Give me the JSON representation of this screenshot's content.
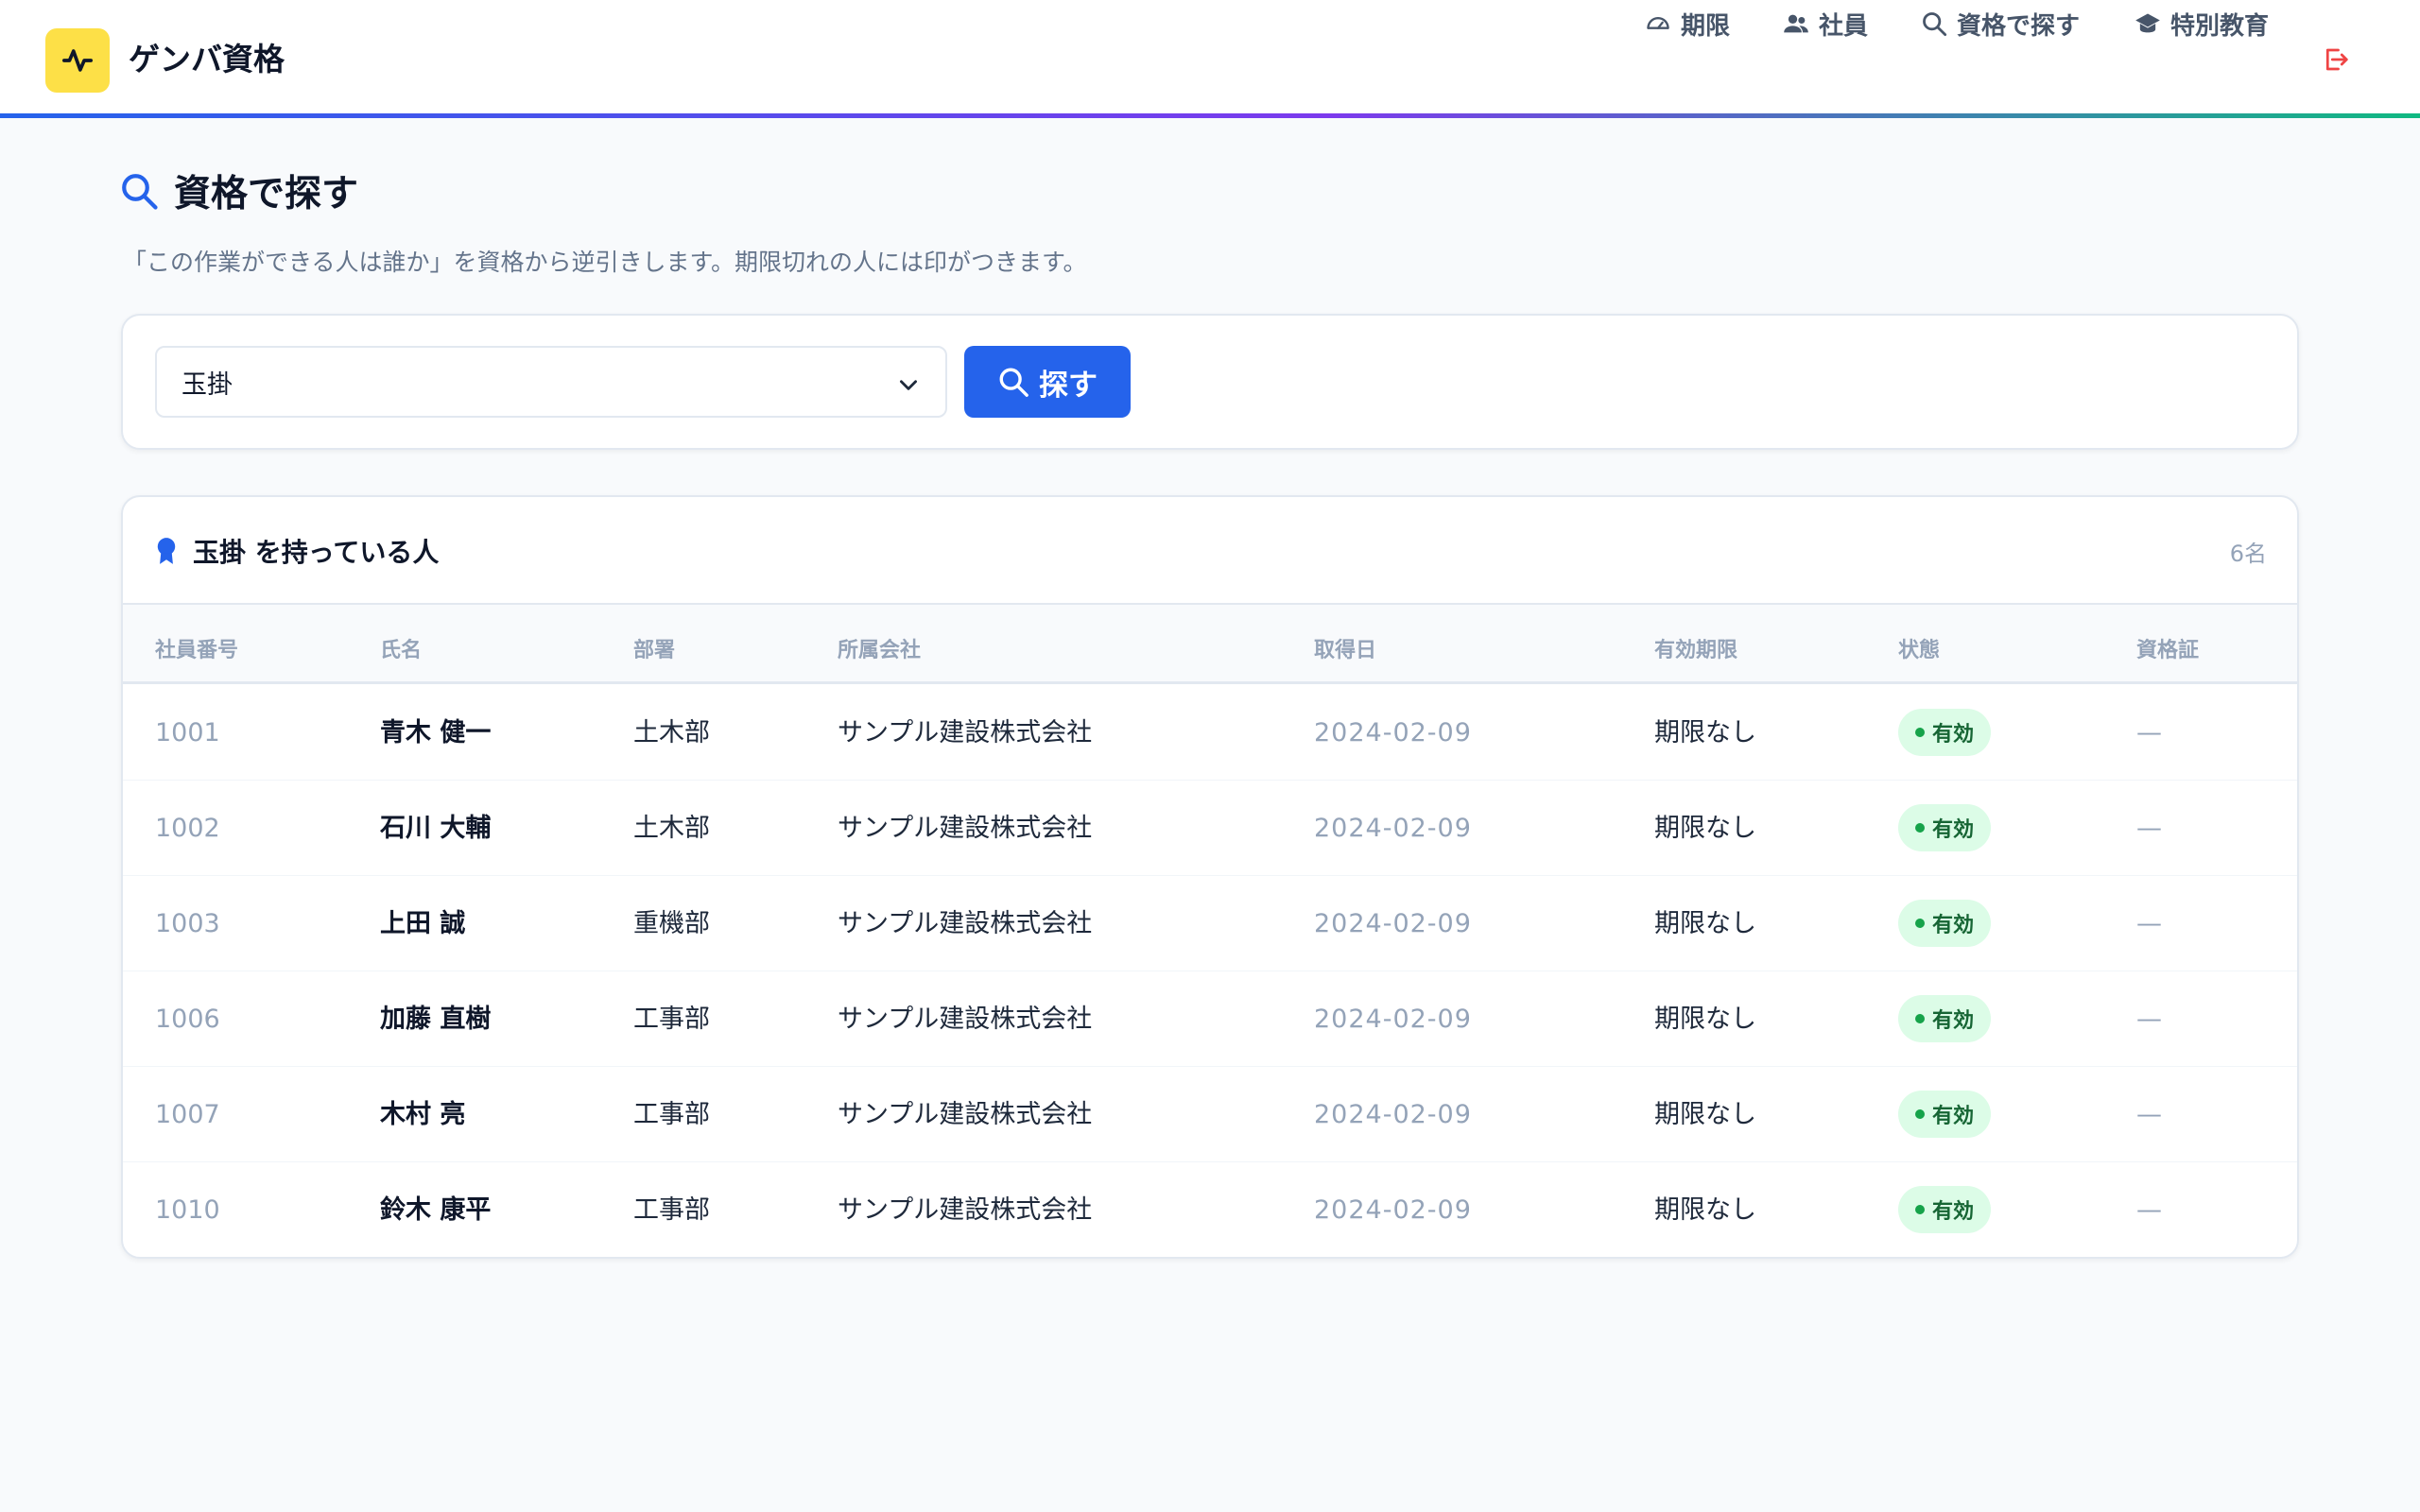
{
  "app": {
    "title": "ゲンバ資格",
    "accent": "#2563eb",
    "logo_color": "#fde047"
  },
  "nav": [
    {
      "label": "期限",
      "icon": "gauge-icon"
    },
    {
      "label": "社員",
      "icon": "users-icon"
    },
    {
      "label": "資格で探す",
      "icon": "search-icon"
    },
    {
      "label": "特別教育",
      "icon": "graduation-cap-icon"
    }
  ],
  "page": {
    "title": "資格で探す",
    "subtitle": "「この作業ができる人は誰か」を資格から逆引きします。期限切れの人には印がつきます。"
  },
  "search": {
    "selected": "玉掛",
    "button_label": "探す"
  },
  "results": {
    "title": "玉掛 を持っている人",
    "count": "6名",
    "columns": [
      "社員番号",
      "氏名",
      "部署",
      "所属会社",
      "取得日",
      "有効期限",
      "状態",
      "資格証"
    ],
    "rows": [
      {
        "emp_no": "1001",
        "name": "青木 健一",
        "dept": "土木部",
        "company": "サンプル建設株式会社",
        "acquired": "2024-02-09",
        "expiry": "期限なし",
        "status": "有効",
        "cert": "—"
      },
      {
        "emp_no": "1002",
        "name": "石川 大輔",
        "dept": "土木部",
        "company": "サンプル建設株式会社",
        "acquired": "2024-02-09",
        "expiry": "期限なし",
        "status": "有効",
        "cert": "—"
      },
      {
        "emp_no": "1003",
        "name": "上田 誠",
        "dept": "重機部",
        "company": "サンプル建設株式会社",
        "acquired": "2024-02-09",
        "expiry": "期限なし",
        "status": "有効",
        "cert": "—"
      },
      {
        "emp_no": "1006",
        "name": "加藤 直樹",
        "dept": "工事部",
        "company": "サンプル建設株式会社",
        "acquired": "2024-02-09",
        "expiry": "期限なし",
        "status": "有効",
        "cert": "—"
      },
      {
        "emp_no": "1007",
        "name": "木村 亮",
        "dept": "工事部",
        "company": "サンプル建設株式会社",
        "acquired": "2024-02-09",
        "expiry": "期限なし",
        "status": "有効",
        "cert": "—"
      },
      {
        "emp_no": "1010",
        "name": "鈴木 康平",
        "dept": "工事部",
        "company": "サンプル建設株式会社",
        "acquired": "2024-02-09",
        "expiry": "期限なし",
        "status": "有効",
        "cert": "—"
      }
    ]
  }
}
